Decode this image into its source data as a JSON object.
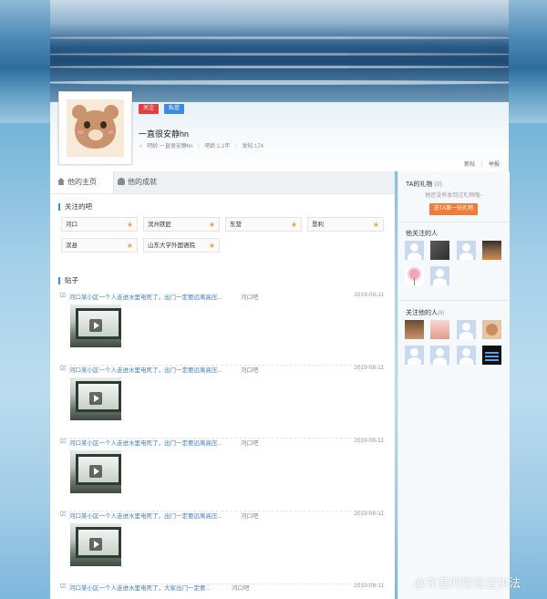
{
  "profile": {
    "follow_label": "关注",
    "message_label": "私信",
    "username": "一直很安静hn",
    "bar_age": "吧龄:一直很安静hn",
    "bar_age_label": "吧龄:1.1年",
    "posts_count": "发帖:174"
  },
  "toplinks": {
    "link1": "新帖",
    "link2": "举报"
  },
  "tabs": [
    {
      "label": "他的主页"
    },
    {
      "label": "他的成就"
    }
  ],
  "followed_bars": {
    "title": "关注的吧",
    "items": [
      {
        "name": "河口"
      },
      {
        "name": "滨州铁匠"
      },
      {
        "name": "东营"
      },
      {
        "name": "垦利"
      },
      {
        "name": "滨县"
      },
      {
        "name": "山东大学外国语院"
      }
    ]
  },
  "posts_section": {
    "title": "贴子"
  },
  "posts": [
    {
      "title": "河口某小区一个人走进水里电死了，出门一定要远离高压...",
      "bar": "河口吧",
      "date": "2019-08-11"
    },
    {
      "title": "河口某小区一个人走进水里电死了，出门一定要远离高压...",
      "bar": "河口吧",
      "date": "2019-08-11"
    },
    {
      "title": "河口某小区一个人走进水里电死了，出门一定要远离高压...",
      "bar": "河口吧",
      "date": "2019-08-11"
    },
    {
      "title": "河口某小区一个人走进水里电死了，出门一定要远离高压...",
      "bar": "河口吧",
      "date": "2019-08-11"
    },
    {
      "title": "河口某小区一个人走进水里电死了，大家出门一定要...",
      "bar": "河口吧",
      "date": "2019-08-11"
    }
  ],
  "sidebar": {
    "gifts_title": "TA的礼物",
    "gifts_count": "(0)",
    "gifts_desc": "他还没有收到过礼物哦~",
    "gift_button": "送TA第一份礼物",
    "following_title": "他关注的人",
    "followers_title": "关注他的人",
    "followers_count": "(8)"
  },
  "watermark": "@东营网警巡查执法",
  "colors": {
    "accent": "#3d8be0",
    "follow": "#e0403f",
    "gift": "#f07b3a"
  }
}
